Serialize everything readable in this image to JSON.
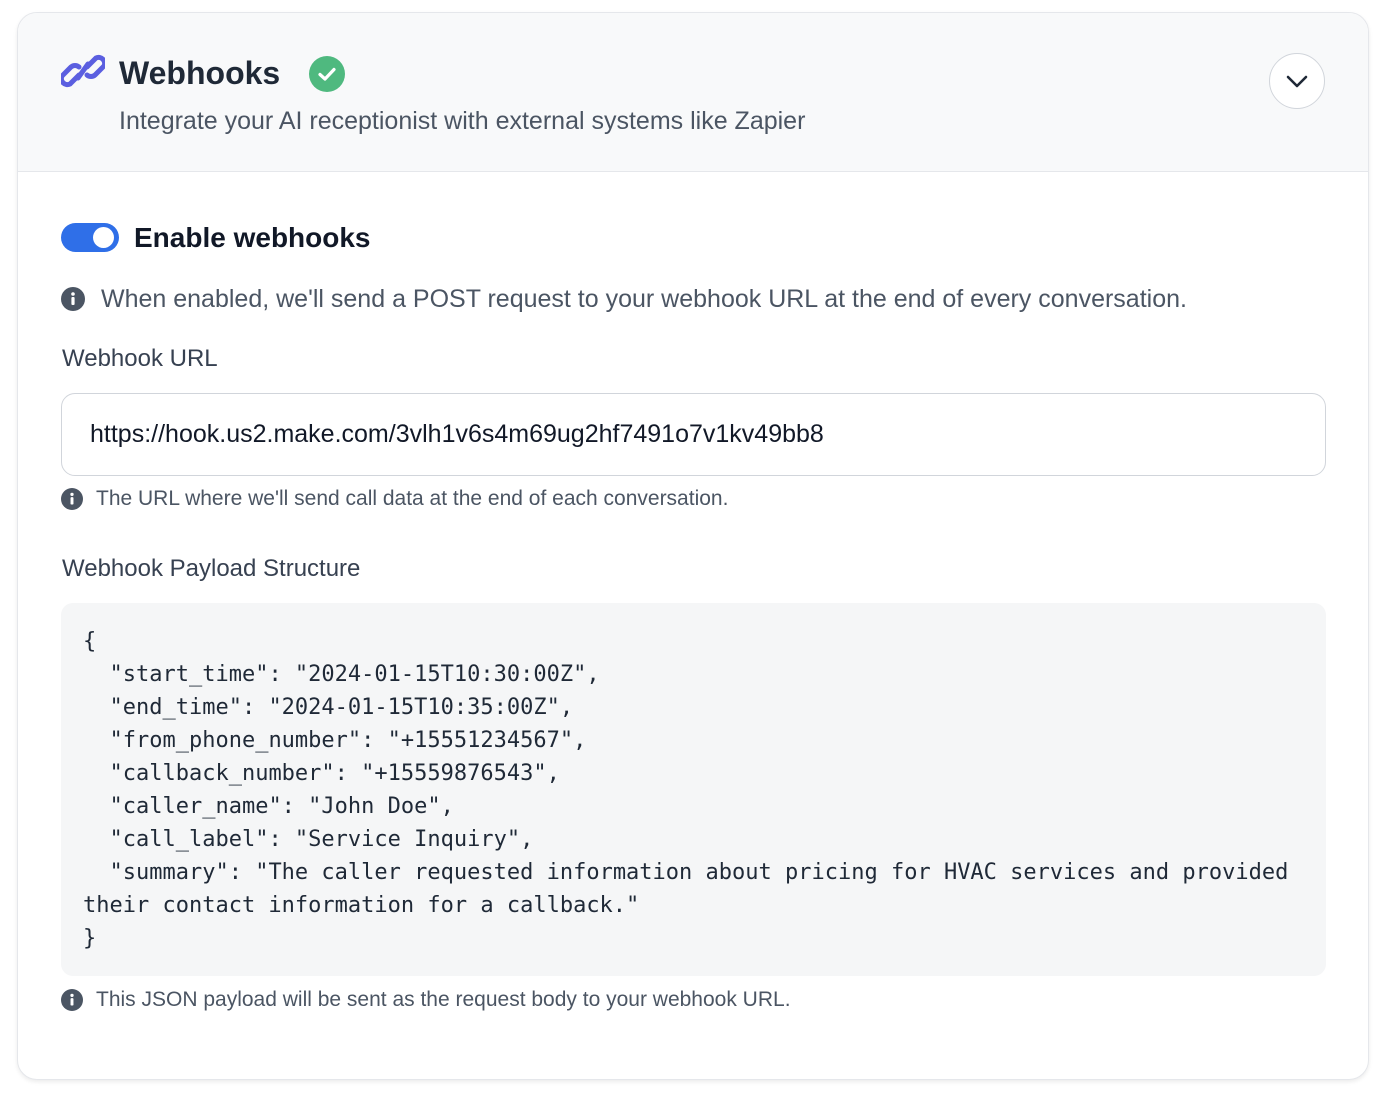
{
  "header": {
    "title": "Webhooks",
    "subtitle": "Integrate your AI receptionist with external systems like Zapier",
    "icons": {
      "title_icon": "link-icon",
      "status_icon": "check-circle-icon",
      "collapse_icon": "chevron-down-icon"
    },
    "colors": {
      "link_icon": "#5b5fe0",
      "status_success": "#4fb97f"
    }
  },
  "settings": {
    "toggle_label": "Enable webhooks",
    "toggle_state": "on",
    "toggle_color": "#2f6fe8",
    "info_text": "When enabled, we'll send a POST request to your webhook URL at the end of every conversation."
  },
  "url_field": {
    "label": "Webhook URL",
    "value": "https://hook.us2.make.com/3vlh1v6s4m69ug2hf7491o7v1kv49bb8",
    "hint": "The URL where we'll send call data at the end of each conversation."
  },
  "payload": {
    "label": "Webhook Payload Structure",
    "code": "{\n  \"start_time\": \"2024-01-15T10:30:00Z\",\n  \"end_time\": \"2024-01-15T10:35:00Z\",\n  \"from_phone_number\": \"+15551234567\",\n  \"callback_number\": \"+15559876543\",\n  \"caller_name\": \"John Doe\",\n  \"call_label\": \"Service Inquiry\",\n  \"summary\": \"The caller requested information about pricing for HVAC services and provided their contact information for a callback.\"\n}",
    "hint": "This JSON payload will be sent as the request body to your webhook URL."
  }
}
